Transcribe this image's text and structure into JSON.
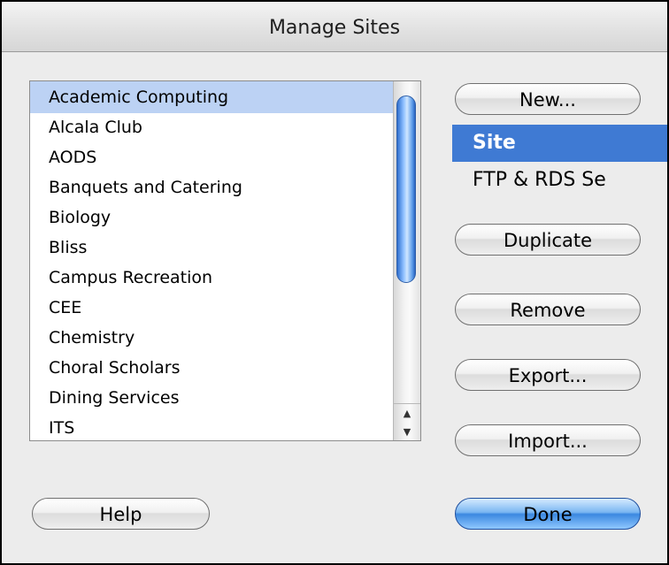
{
  "window": {
    "title": "Manage Sites"
  },
  "sites": {
    "items": [
      "Academic Computing",
      "Alcala Club",
      "AODS",
      "Banquets and Catering",
      "Biology",
      "Bliss",
      "Campus Recreation",
      "CEE",
      "Chemistry",
      "Choral Scholars",
      "Dining Services",
      "ITS"
    ],
    "selected": "Academic Computing"
  },
  "buttons": {
    "new": "New...",
    "duplicate": "Duplicate",
    "remove": "Remove",
    "export": "Export...",
    "import": "Import...",
    "help": "Help",
    "done": "Done"
  },
  "new_menu": {
    "items": [
      "Site",
      "FTP & RDS Se"
    ],
    "highlighted": "Site"
  },
  "icons": {
    "scroll_up": "scroll-up-arrow-icon",
    "scroll_down": "scroll-down-arrow-icon"
  },
  "colors": {
    "selection": "#bcd2f4",
    "menu_highlight": "#3f7ad3",
    "default_button": "#3b88e0"
  }
}
